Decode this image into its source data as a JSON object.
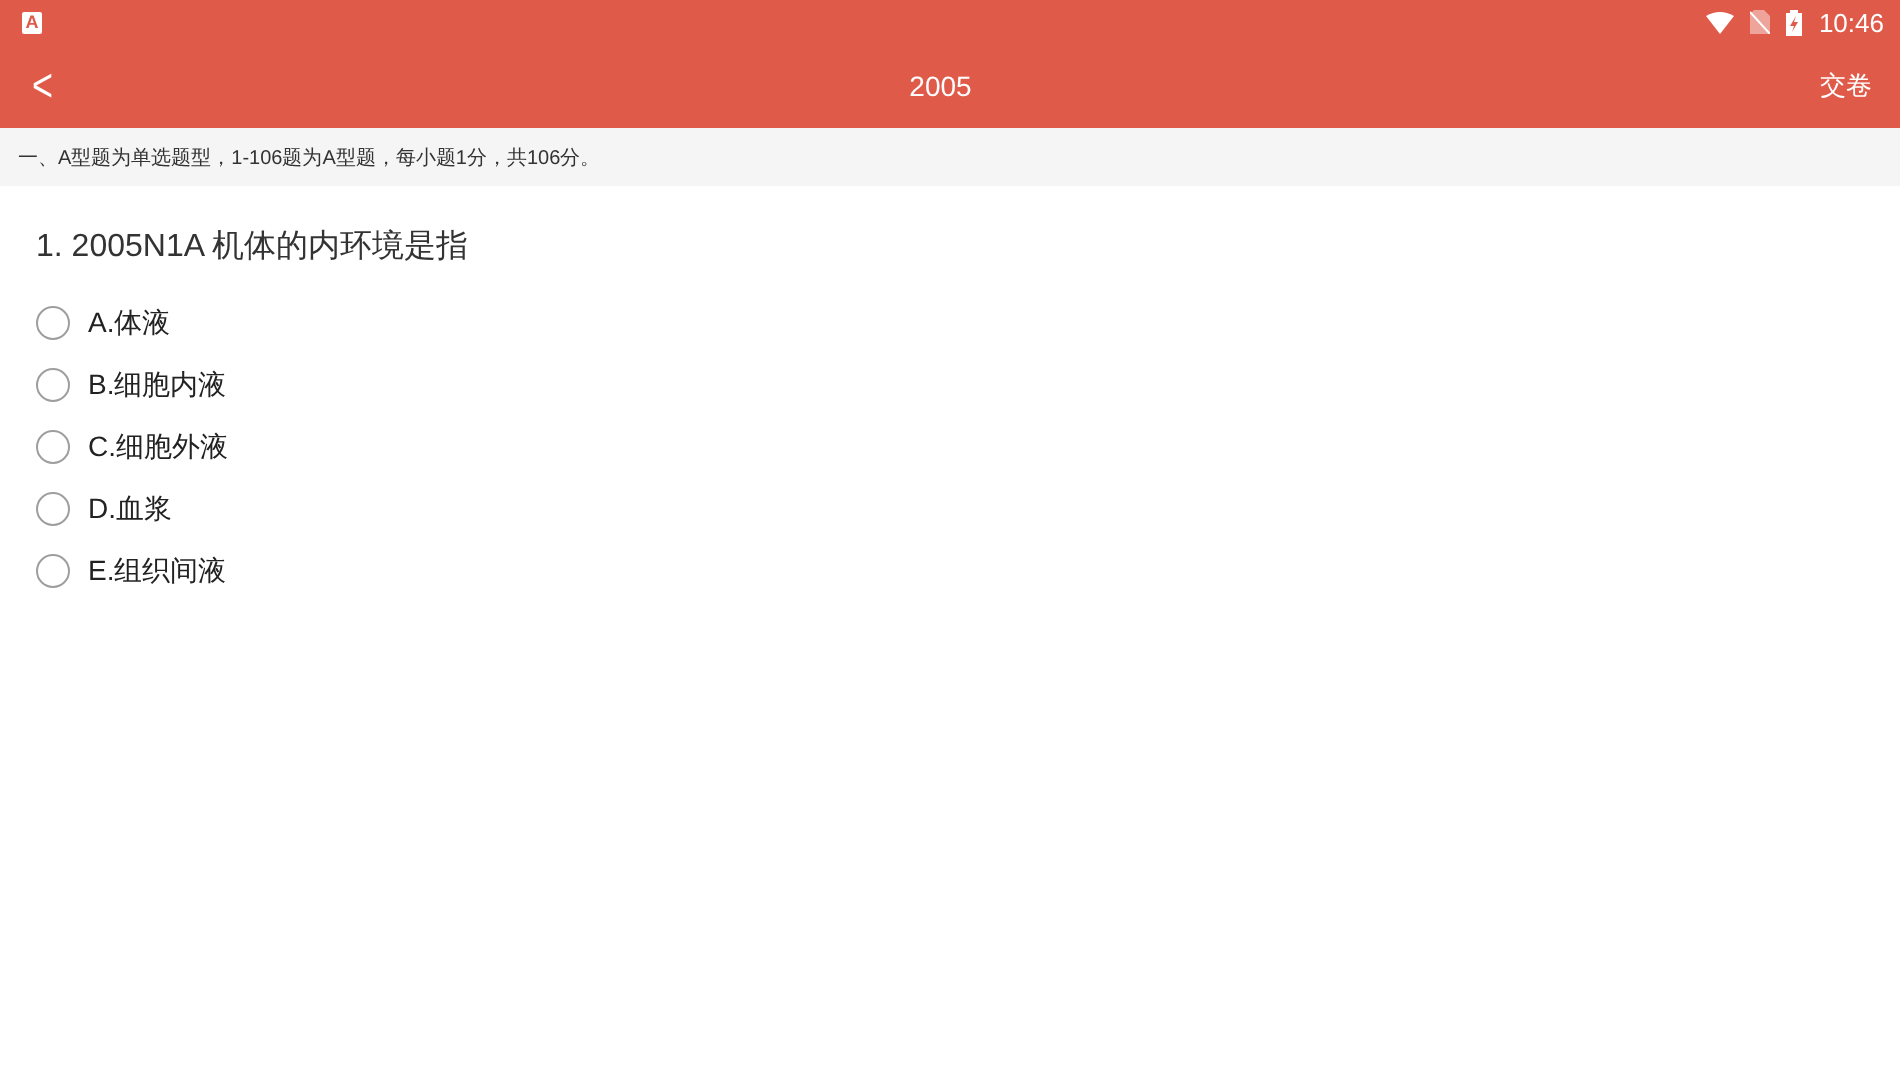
{
  "status_bar": {
    "app_badge": "A",
    "time": "10:46"
  },
  "app_bar": {
    "back": "<",
    "title": "2005",
    "action": "交卷"
  },
  "section_note": "一、A型题为单选题型，1-106题为A型题，每小题1分，共106分。",
  "question": {
    "text": "1. 2005N1A 机体的内环境是指",
    "options": [
      {
        "label": "A.体液",
        "selected": false
      },
      {
        "label": "B.细胞内液",
        "selected": false
      },
      {
        "label": "C.细胞外液",
        "selected": false
      },
      {
        "label": "D.血浆",
        "selected": false
      },
      {
        "label": "E.组织间液",
        "selected": false
      }
    ]
  }
}
